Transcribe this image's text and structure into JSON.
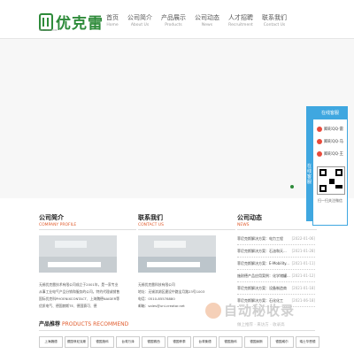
{
  "brand": {
    "logo_text": "优克雷",
    "logo_sub": "UNI-CREATOR"
  },
  "nav": [
    {
      "cn": "首页",
      "en": "Home"
    },
    {
      "cn": "公司简介",
      "en": "About Us"
    },
    {
      "cn": "产品展示",
      "en": "Products"
    },
    {
      "cn": "公司动态",
      "en": "News"
    },
    {
      "cn": "人才招聘",
      "en": "Recruitment"
    },
    {
      "cn": "联系我们",
      "en": "Contact Us"
    }
  ],
  "float_panel": {
    "title": "在线客服",
    "tab_text": "在线客服",
    "contacts": [
      "卿彩QQ·雷",
      "卿彩QQ·马",
      "卿彩QQ·王"
    ],
    "scan_text": "扫一扫关注微信"
  },
  "about": {
    "title": "公司简介",
    "subtitle": "COMPANY PROFILE",
    "text": "无锡优克雷技术有限公司成立于2001年，是一家专业从事工业电气产品分销和服务的公司，特约代理或销售国际优克科PHOENIXCONTACT、上海魏德NAIDER等优质电气、德国赫斯TE、德国赛可、德"
  },
  "contact": {
    "title": "联系我们",
    "subtitle": "CONTACT US",
    "company": "无锡优克雷科技有限公司",
    "address": "地址：无锡滨湖区建设中路宝月路23号1003",
    "phone": "电话：0510-85578880",
    "email": "邮箱：sales@uni-creator.net"
  },
  "news": {
    "title": "公司动态",
    "subtitle": "NEWS",
    "items": [
      {
        "title": "菲尼克斯解决方案：电力工程",
        "date": "[2022-01-06]"
      },
      {
        "title": "菲尼克斯解决方案：石油和天...",
        "date": "[2021-01-28]"
      },
      {
        "title": "菲尼克斯解决方案：E-Mobility...",
        "date": "[2021-01-11]"
      },
      {
        "title": "施耐德产品应用案例：化学储罐...",
        "date": "[2021-01-12]"
      },
      {
        "title": "菲尼克斯解决方案：设备制造商",
        "date": "[2021-01-18]"
      },
      {
        "title": "菲尼克斯解决方案：石化化工",
        "date": "[2021-06-18]"
      }
    ]
  },
  "products": {
    "title": "产品推荐",
    "subtitle": "PRODUCTS RECOMMEND",
    "tabs": [
      "上海魏德",
      "德国菲尼克斯",
      "德国施科",
      "台湾万泽",
      "德国赛西",
      "德国菲泰",
      "台湾衡德",
      "德国施科",
      "德国赫斯",
      "德国威尔",
      "瑞士华恩德"
    ]
  },
  "watermark": {
    "text": "自动秘收录",
    "sub": "做上推荐 · 来访方 · 收录高"
  }
}
